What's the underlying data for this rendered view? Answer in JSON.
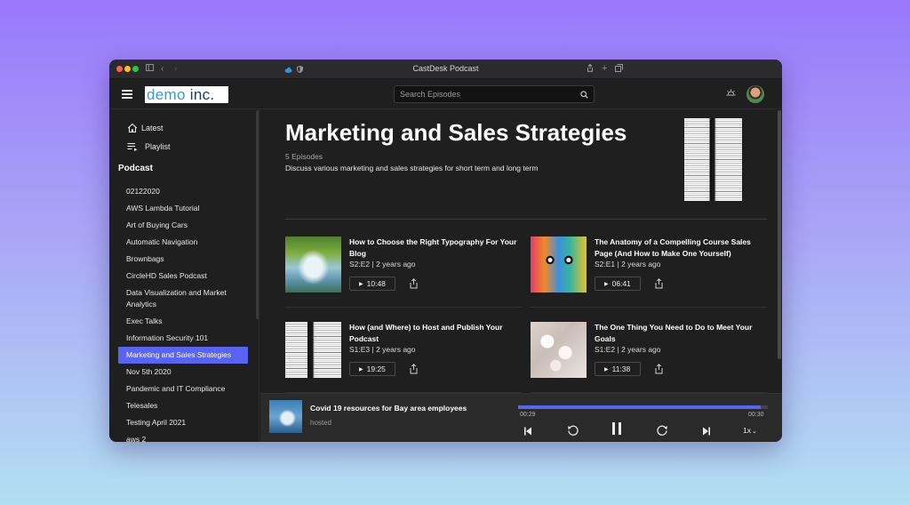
{
  "window": {
    "title": "CastDesk Podcast",
    "traffic_colors": [
      "#fe5f57",
      "#febc2e",
      "#28c840"
    ]
  },
  "appbar": {
    "logo_part1": "demo",
    "logo_part2": "inc.",
    "search": {
      "placeholder": "Search Episodes",
      "value": ""
    }
  },
  "sidebar": {
    "nav": [
      {
        "label": "Latest",
        "icon": "home-icon"
      },
      {
        "label": "Playlist",
        "icon": "playlist-icon"
      }
    ],
    "section_title": "Podcast",
    "podcasts": [
      "02122020",
      "AWS Lambda Tutorial",
      "Art of Buying Cars",
      "Automatic Navigation",
      "Brownbags",
      "CircleHD Sales Podcast",
      "Data Visualization and Market Analytics",
      "Exec Talks",
      "Information Security 101",
      "Marketing and Sales Strategies",
      "Nov 5th 2020",
      "Pandemic and IT Compliance",
      "Telesales",
      "Testing April 2021",
      "aws 2"
    ],
    "active_index": 9,
    "accent": "#5a64ee"
  },
  "main": {
    "title": "Marketing and Sales Strategies",
    "count": "5 Episodes",
    "description": "Discuss various marketing and sales strategies for short term and long term",
    "episodes": [
      {
        "title": "How to Choose the Right Typography For Your Blog",
        "meta": "S2:E2 | 2 years ago",
        "duration": "10:48",
        "thumb": "waterfall"
      },
      {
        "title": "The Anatomy of a Compelling Course Sales Page (And How to Make One Yourself)",
        "meta": "S2:E1 | 2 years ago",
        "duration": "06:41",
        "thumb": "face"
      },
      {
        "title": "How (and Where) to Host and Publish Your Podcast",
        "meta": "S1:E3 | 2 years ago",
        "duration": "19:25",
        "thumb": "paper"
      },
      {
        "title": "The One Thing You Need to Do to Meet Your Goals",
        "meta": "S1:E2 | 2 years ago",
        "duration": "11:38",
        "thumb": "blossom"
      }
    ]
  },
  "player": {
    "title": "Covid 19 resources for Bay area employees",
    "subtitle": "hosted",
    "elapsed": "00:29",
    "total": "00:30",
    "progress_fraction": 0.97,
    "speed": "1x"
  }
}
